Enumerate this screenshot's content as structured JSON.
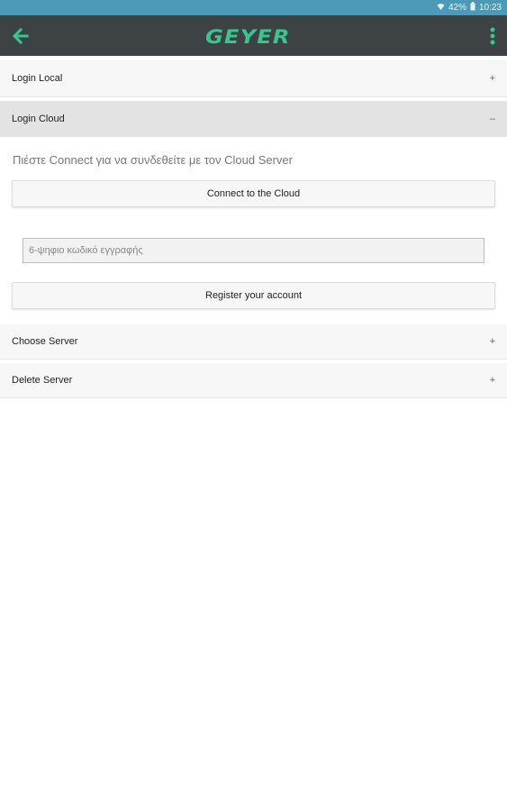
{
  "status_bar": {
    "battery": "42%",
    "time": "10:23"
  },
  "toolbar": {
    "logo": "GEYER",
    "back_icon": "arrow-left-icon",
    "menu_icon": "more-vert-icon"
  },
  "sections": {
    "login_local": {
      "label": "Login Local",
      "toggle": "+"
    },
    "login_cloud": {
      "label": "Login Cloud",
      "toggle": "–"
    },
    "choose_server": {
      "label": "Choose Server",
      "toggle": "+"
    },
    "delete_server": {
      "label": "Delete Server",
      "toggle": "+"
    }
  },
  "cloud": {
    "hint": "Πιέστε Connect για να συνδεθείτε με τον Cloud Server",
    "connect_label": "Connect to the Cloud",
    "code_placeholder": "6-ψηφιο κωδικό εγγραφής",
    "register_label": "Register your account"
  },
  "colors": {
    "status_bar": "#4a9ab8",
    "toolbar": "#3d4245",
    "accent": "#38c58f"
  }
}
